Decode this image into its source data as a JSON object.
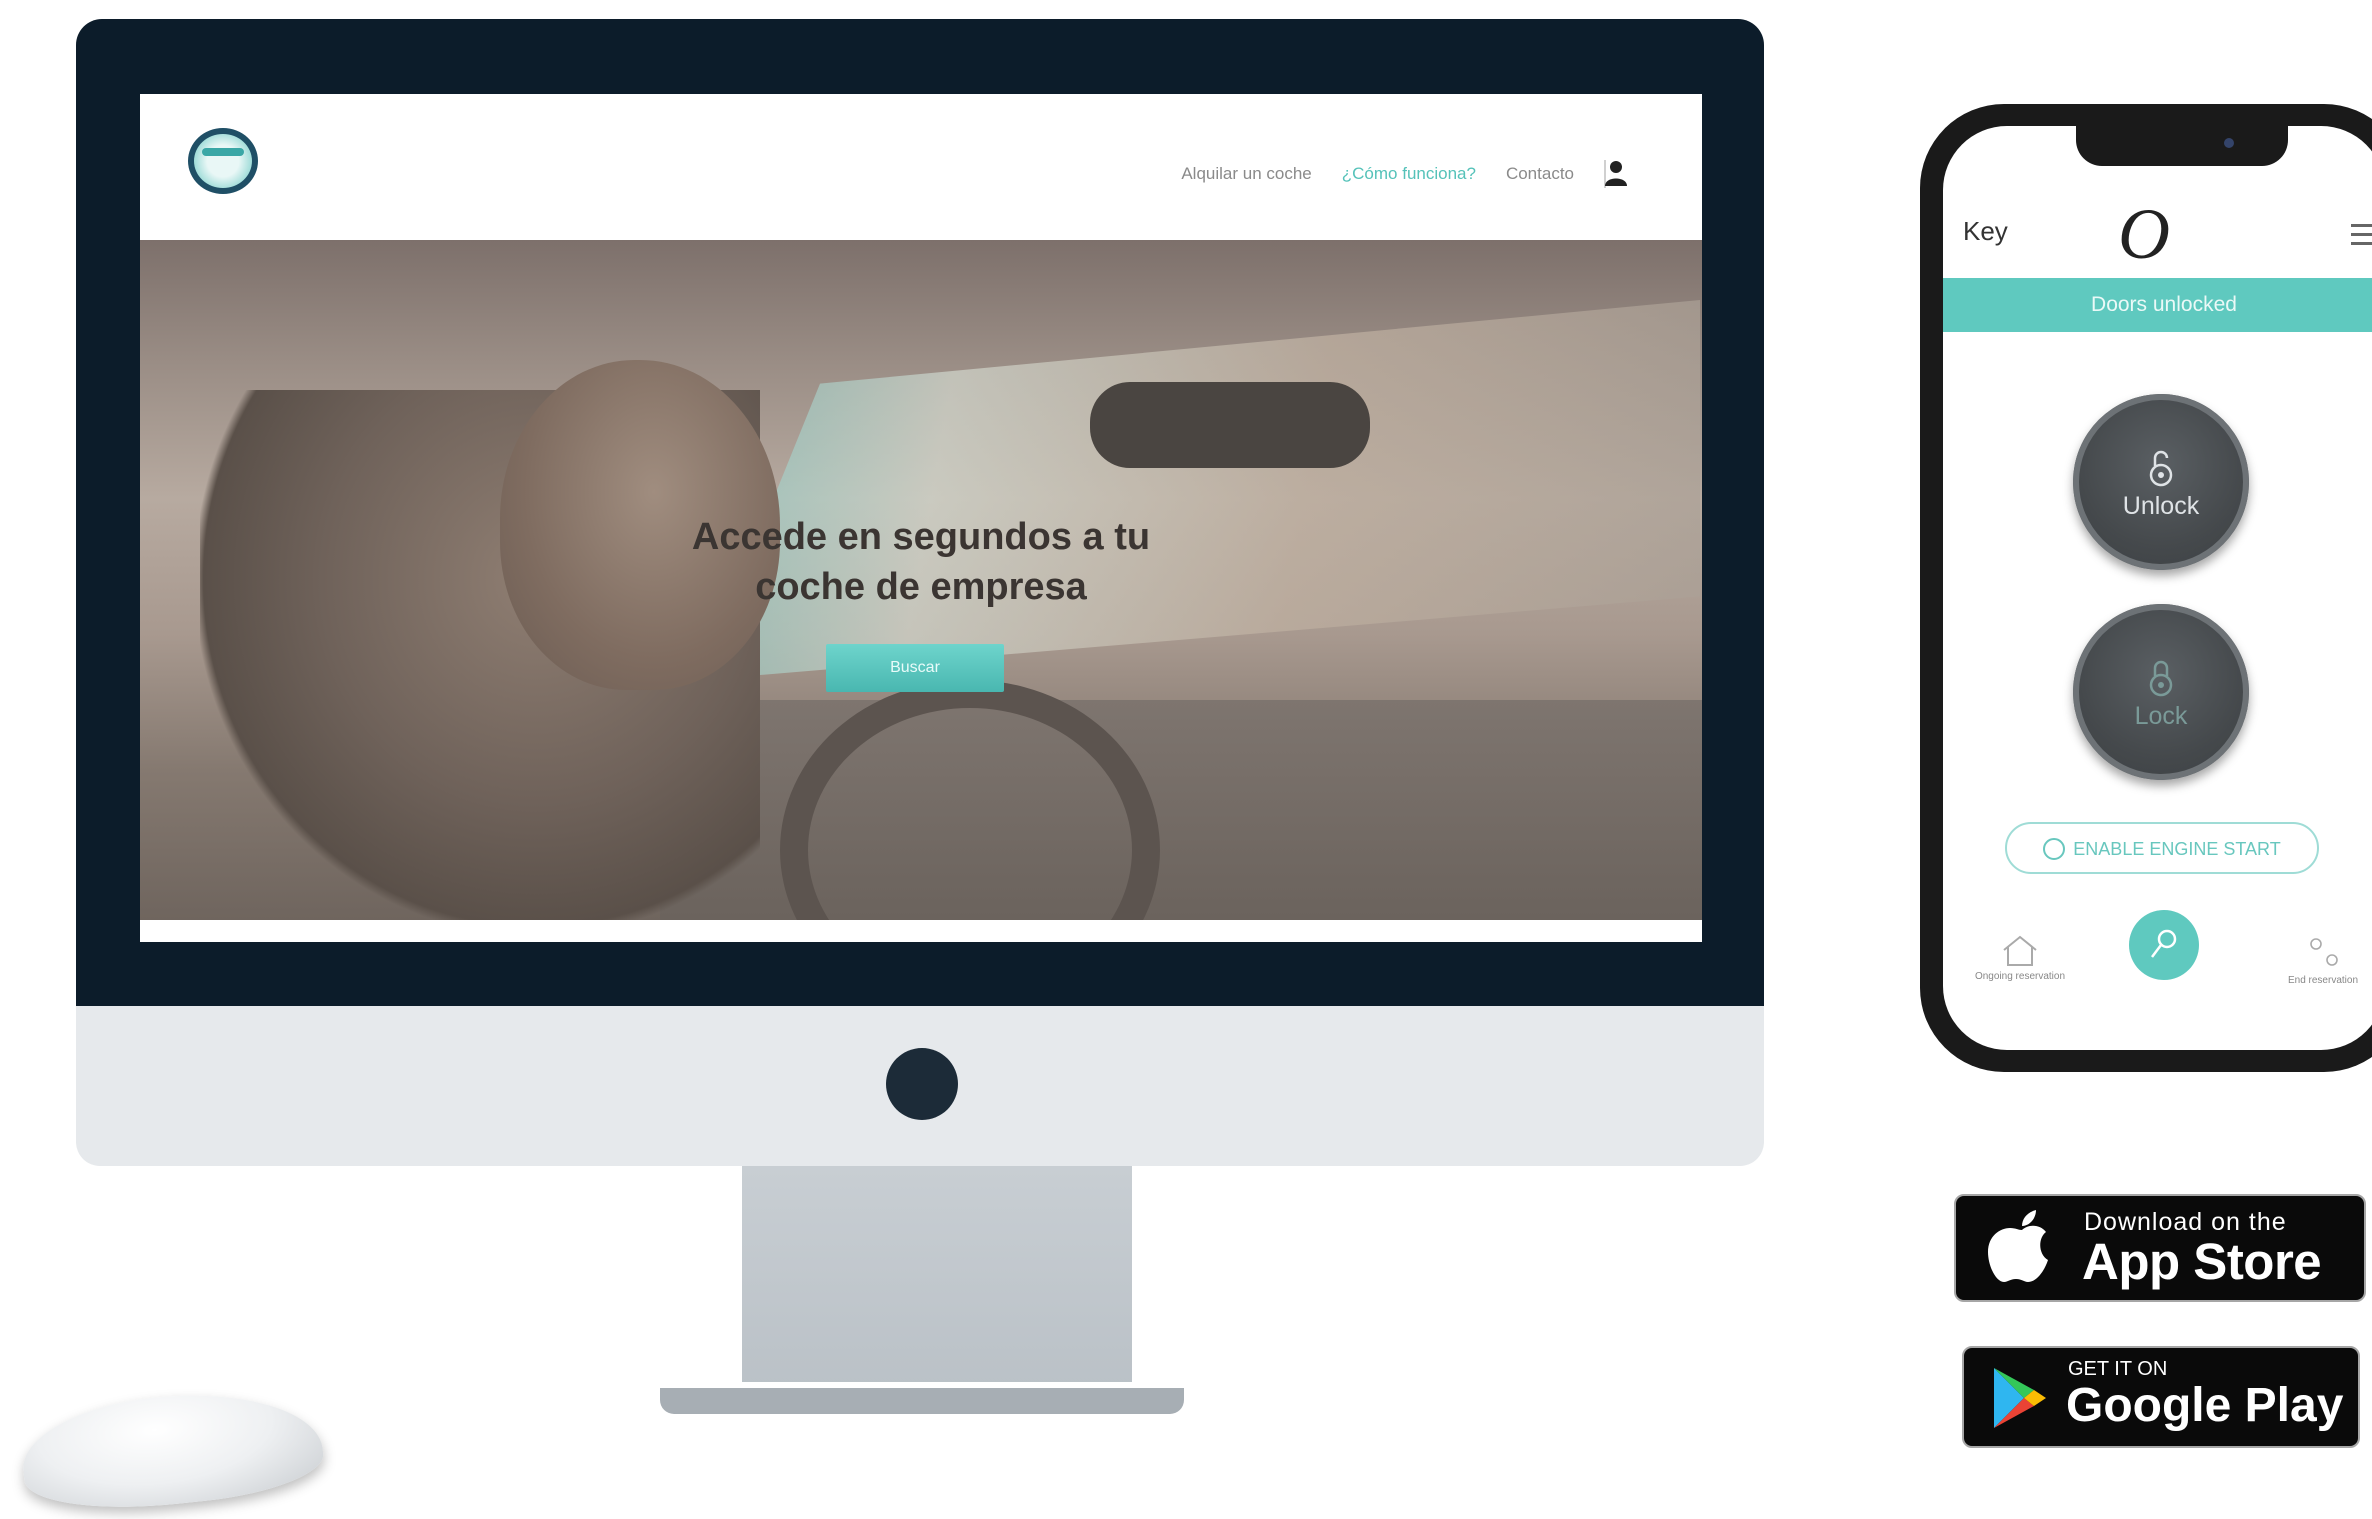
{
  "website": {
    "nav": {
      "item1": "Alquilar un coche",
      "item2": "¿Cómo funciona?",
      "item3": "Contacto"
    },
    "hero": {
      "line1": "Accede en segundos a tu",
      "line2": "coche de empresa",
      "button": "Buscar"
    }
  },
  "app": {
    "title": "Key",
    "logo": "O",
    "status": "Doors unlocked",
    "unlock_label": "Unlock",
    "lock_label": "Lock",
    "engine_label": "ENABLE ENGINE START",
    "tab_left": "Ongoing reservation",
    "tab_right": "End reservation"
  },
  "badges": {
    "appstore_small": "Download on the",
    "appstore_big": "App Store",
    "gplay_small": "GET IT ON",
    "gplay_big": "Google Play"
  },
  "colors": {
    "accent": "#5fc9bf",
    "imac_frame": "#0c1c2a"
  }
}
